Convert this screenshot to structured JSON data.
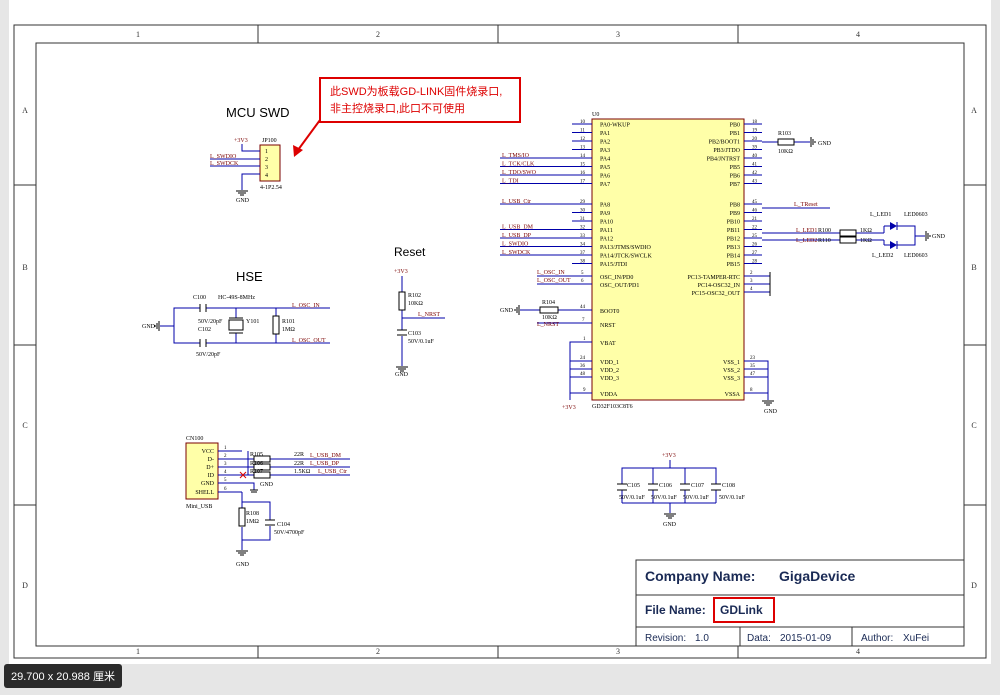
{
  "zones": {
    "top": [
      "1",
      "2",
      "3",
      "4"
    ],
    "bottom": [
      "1",
      "2",
      "3",
      "4"
    ],
    "left": [
      "A",
      "B",
      "C",
      "D"
    ],
    "right": [
      "A",
      "B",
      "C",
      "D"
    ]
  },
  "annotation": {
    "line1": "此SWD为板载GD-LINK固件烧录口,",
    "line2": "非主控烧录口,此口不可使用"
  },
  "swd": {
    "title": "MCU SWD",
    "ref": "JP100",
    "footprint": "4-1P2.54",
    "vcc": "+3V3",
    "gnd": "GND",
    "nets": [
      "L_SWDIO",
      "L_SWDCK"
    ],
    "pins": [
      "1",
      "2",
      "3",
      "4"
    ]
  },
  "hse": {
    "title": "HSE",
    "gnd": "GND",
    "crystal_part": "HC-49S-8MHz",
    "crystal_ref": "Y101",
    "c1_ref": "C100",
    "c1_val": "50V/20pF",
    "c2_ref": "C102",
    "c2_val": "50V/20pF",
    "r_ref": "R101",
    "r_val": "1MΩ",
    "net_in": "L_OSC_IN",
    "net_out": "L_OSC_OUT"
  },
  "reset": {
    "title": "Reset",
    "vcc": "+3V3",
    "r_ref": "R102",
    "r_val": "10KΩ",
    "net": "L_NRST",
    "c_ref": "C103",
    "c_val": "50V/0.1uF",
    "gnd": "GND"
  },
  "usb": {
    "ref": "CN100",
    "name": "Mini_USB",
    "pins": [
      "VCC",
      "D-",
      "D+",
      "ID",
      "GND"
    ],
    "shell": "SHELL",
    "pin_nums": [
      "1",
      "2",
      "3",
      "4",
      "5",
      "6"
    ],
    "r105": "R105",
    "r105_val": "22R",
    "net_dm": "L_USB_DM",
    "r106": "R106",
    "r106_val": "22R",
    "net_dp": "L_USB_DP",
    "r107": "R107",
    "r107_val": "1.5KΩ",
    "net_ctr": "L_USB_Ctr",
    "gnd": "GND",
    "r108": "R108",
    "r108_val": "1MΩ",
    "c104": "C104",
    "c104_val": "50V/4700pF",
    "gnd2": "GND"
  },
  "mcu": {
    "ref": "U0",
    "part": "GD32F103C8T6",
    "left_pins": [
      {
        "num": "10",
        "name": "PA0-WKUP",
        "net": ""
      },
      {
        "num": "11",
        "name": "PA1",
        "net": ""
      },
      {
        "num": "12",
        "name": "PA2",
        "net": ""
      },
      {
        "num": "13",
        "name": "PA3",
        "net": ""
      },
      {
        "num": "14",
        "name": "PA4",
        "net": "L_TMS/IO"
      },
      {
        "num": "15",
        "name": "PA5",
        "net": "L_TCK/CLK"
      },
      {
        "num": "16",
        "name": "PA6",
        "net": "L_TDO/SWO"
      },
      {
        "num": "17",
        "name": "PA7",
        "net": "L_TDI"
      },
      {
        "num": "29",
        "name": "PA8",
        "net": "L_USB_Ctr"
      },
      {
        "num": "30",
        "name": "PA9",
        "net": ""
      },
      {
        "num": "31",
        "name": "PA10",
        "net": ""
      },
      {
        "num": "32",
        "name": "PA11",
        "net": "L_USB_DM"
      },
      {
        "num": "33",
        "name": "PA12",
        "net": "L_USB_DP"
      },
      {
        "num": "34",
        "name": "PA13/JTMS/SWDIO",
        "net": "L_SWDIO"
      },
      {
        "num": "37",
        "name": "PA14/JTCK/SWCLK",
        "net": "L_SWDCK"
      },
      {
        "num": "38",
        "name": "PA15/JTDI",
        "net": ""
      }
    ],
    "right_pins": [
      {
        "num": "18",
        "name": "PB0"
      },
      {
        "num": "19",
        "name": "PB1"
      },
      {
        "num": "20",
        "name": "PB2/BOOT1"
      },
      {
        "num": "39",
        "name": "PB3/JTDO"
      },
      {
        "num": "40",
        "name": "PB4/JNTRST"
      },
      {
        "num": "41",
        "name": "PB5"
      },
      {
        "num": "42",
        "name": "PB6"
      },
      {
        "num": "43",
        "name": "PB7"
      },
      {
        "num": "45",
        "name": "PB8"
      },
      {
        "num": "46",
        "name": "PB9"
      },
      {
        "num": "21",
        "name": "PB10"
      },
      {
        "num": "22",
        "name": "PB11"
      },
      {
        "num": "25",
        "name": "PB12"
      },
      {
        "num": "26",
        "name": "PB13"
      },
      {
        "num": "27",
        "name": "PB14"
      },
      {
        "num": "28",
        "name": "PB15"
      }
    ],
    "osc_in": "OSC_IN/PD0",
    "osc_out": "OSC_OUT/PD1",
    "osc_in_num": "5",
    "osc_out_num": "6",
    "net_osc_in": "L_OSC_IN",
    "net_osc_out": "L_OSC_OUT",
    "boot0": "BOOT0",
    "boot0_num": "44",
    "r104": "R104",
    "r104_val": "10KΩ",
    "gnd_boot": "GND",
    "nrst": "NRST",
    "nrst_num": "7",
    "net_nrst": "L_NRST",
    "vbat": "VBAT",
    "vbat_num": "1",
    "vdd": [
      "VDD_1",
      "VDD_2",
      "VDD_3"
    ],
    "vdd_nums": [
      "24",
      "36",
      "48"
    ],
    "vdda": "VDDA",
    "vdda_num": "9",
    "vcc": "+3V3",
    "tamper": [
      "PC13-TAMPER-RTC",
      "PC14-OSC32_IN",
      "PC15-OSC32_OUT"
    ],
    "tamper_nums": [
      "2",
      "3",
      "4"
    ],
    "vss": [
      "VSS_1",
      "VSS_2",
      "VSS_3"
    ],
    "vss_nums": [
      "23",
      "35",
      "47"
    ],
    "vssa": "VSSA",
    "vssa_num": "8",
    "gnd": "GND",
    "r103": "R103",
    "r103_val": "10KΩ",
    "gnd_r103": "GND",
    "net_treset": "L_TReset"
  },
  "leds": {
    "led1_net": "L_LED1",
    "led1_r": "R100",
    "led1_r_val": "1KΩ",
    "led1_name": "L_LED1",
    "led1_part": "LED0603",
    "led2_net": "L_LED2",
    "led2_r": "R110",
    "led2_r_val": "1KΩ",
    "led2_name": "L_LED2",
    "led2_part": "LED0603",
    "gnd": "GND"
  },
  "decoupling": {
    "vcc": "+3V3",
    "gnd": "GND",
    "caps": [
      {
        "ref": "C105",
        "val": "50V/0.1uF"
      },
      {
        "ref": "C106",
        "val": "50V/0.1uF"
      },
      {
        "ref": "C107",
        "val": "50V/0.1uF"
      },
      {
        "ref": "C108",
        "val": "50V/0.1uF"
      }
    ]
  },
  "title_block": {
    "company_label": "Company Name:",
    "company": "GigaDevice",
    "file_label": "File Name:",
    "file": "GDLink",
    "revision_label": "Revision:",
    "revision": "1.0",
    "date_label": "Data:",
    "date": "2015-01-09",
    "author_label": "Author:",
    "author": "XuFei"
  },
  "status": {
    "dimensions": "29.700 x 20.988 厘米"
  },
  "colors": {
    "frame": "#7a0000",
    "wire": "#0000aa",
    "net": "#7a0000",
    "mcu_fill": "#ffffa8",
    "highlight": "#dd0000"
  }
}
